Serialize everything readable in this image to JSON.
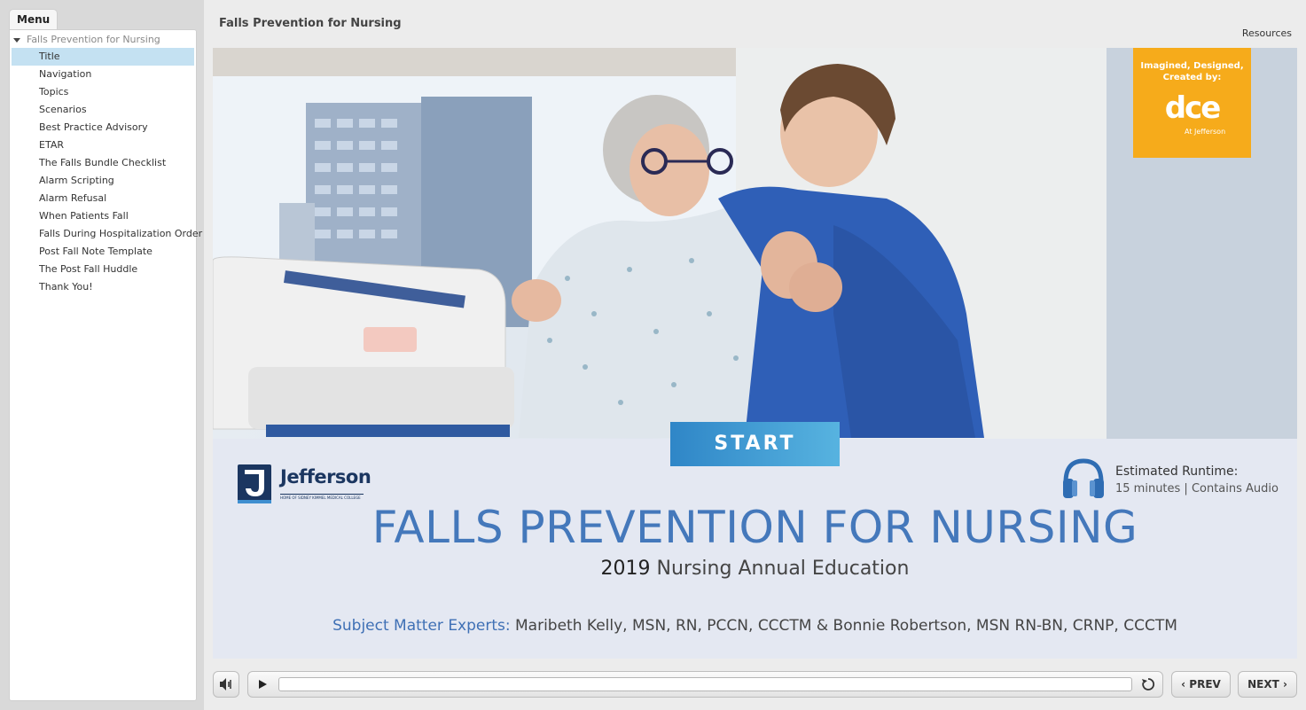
{
  "sidebar": {
    "menu_tab": "Menu",
    "root_label": "Falls Prevention for Nursing",
    "items": [
      {
        "label": "Title",
        "active": true
      },
      {
        "label": "Navigation"
      },
      {
        "label": "Topics"
      },
      {
        "label": "Scenarios"
      },
      {
        "label": "Best Practice Advisory"
      },
      {
        "label": "ETAR"
      },
      {
        "label": "The Falls Bundle Checklist"
      },
      {
        "label": "Alarm Scripting"
      },
      {
        "label": "Alarm Refusal"
      },
      {
        "label": "When Patients Fall"
      },
      {
        "label": "Falls During Hospitalization Order"
      },
      {
        "label": "Post Fall Note Template"
      },
      {
        "label": "The Post Fall Huddle"
      },
      {
        "label": "Thank You!"
      }
    ]
  },
  "header": {
    "course_title": "Falls Prevention for Nursing",
    "resources_label": "Resources"
  },
  "slide": {
    "badge": {
      "line1": "Imagined, Designed,",
      "line2": "Created by:",
      "logo_text": "dce",
      "sub_text": "At Jefferson",
      "color": "#f6ab1b"
    },
    "start_label": "START",
    "jefferson": {
      "name": "Jefferson",
      "tagline": "HOME OF SIDNEY KIMMEL MEDICAL COLLEGE"
    },
    "runtime": {
      "label": "Estimated Runtime:",
      "detail": "15 minutes |  Contains Audio",
      "icon": "headphones-icon"
    },
    "title": "FALLS PREVENTION FOR NURSING",
    "subtitle_year": "2019",
    "subtitle_rest": " Nursing Annual Education",
    "experts_label": "Subject Matter Experts:",
    "experts_names": " Maribeth Kelly, MSN, RN, PCCN, CCCTM & Bonnie Robertson, MSN RN-BN, CRNP, CCCTM",
    "colors": {
      "title": "#4478bb",
      "accent": "#3f70b5"
    }
  },
  "player": {
    "prev_label": "PREV",
    "next_label": "NEXT",
    "icons": [
      "volume-icon",
      "play-icon",
      "replay-icon",
      "chevron-left-icon",
      "chevron-right-icon"
    ]
  }
}
